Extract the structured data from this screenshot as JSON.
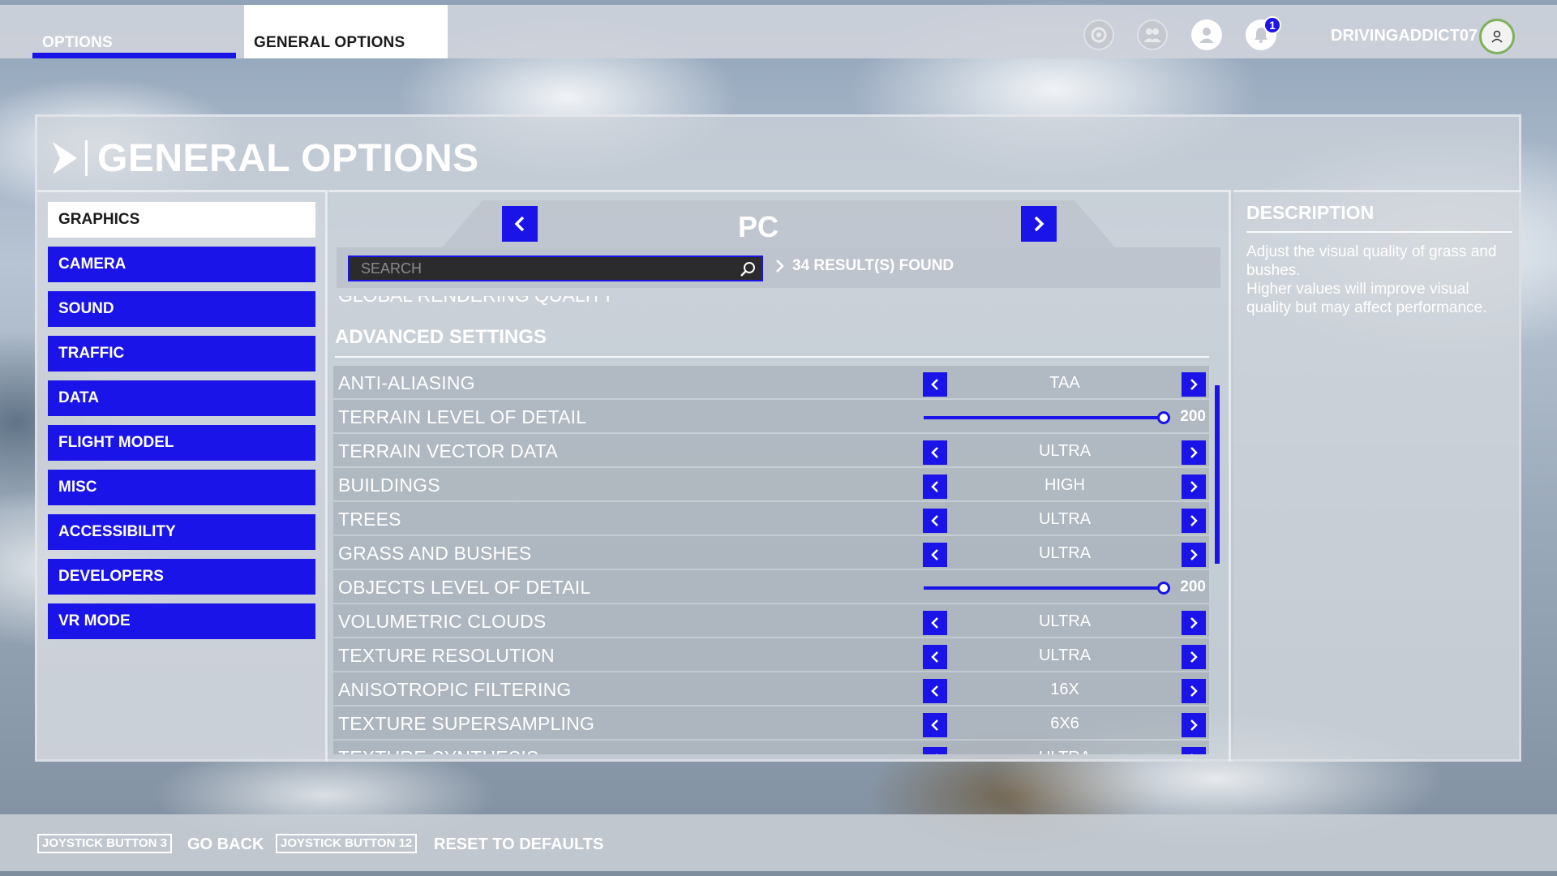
{
  "header": {
    "tabs": [
      {
        "label": "OPTIONS"
      },
      {
        "label": "GENERAL OPTIONS"
      }
    ],
    "notification_count": "1",
    "username": "DRIVINGADDICT07"
  },
  "page_title": "GENERAL OPTIONS",
  "menu": {
    "items": [
      {
        "label": "GRAPHICS",
        "active": true
      },
      {
        "label": "CAMERA"
      },
      {
        "label": "SOUND"
      },
      {
        "label": "TRAFFIC"
      },
      {
        "label": "DATA"
      },
      {
        "label": "FLIGHT MODEL"
      },
      {
        "label": "MISC"
      },
      {
        "label": "ACCESSIBILITY"
      },
      {
        "label": "DEVELOPERS"
      },
      {
        "label": "VR MODE"
      }
    ]
  },
  "preset": {
    "label": "PC"
  },
  "search": {
    "placeholder": "SEARCH",
    "value": ""
  },
  "results_text": "34 RESULT(S) FOUND",
  "cut_row": {
    "label": "GLOBAL RENDERING QUALITY"
  },
  "section_title": "ADVANCED SETTINGS",
  "settings": [
    {
      "label": "ANTI-ALIASING",
      "type": "select",
      "value": "TAA"
    },
    {
      "label": "TERRAIN LEVEL OF DETAIL",
      "type": "slider",
      "value": "200",
      "fraction": 1.0
    },
    {
      "label": "TERRAIN VECTOR DATA",
      "type": "select",
      "value": "ULTRA"
    },
    {
      "label": "BUILDINGS",
      "type": "select",
      "value": "HIGH"
    },
    {
      "label": "TREES",
      "type": "select",
      "value": "ULTRA"
    },
    {
      "label": "GRASS AND BUSHES",
      "type": "select",
      "value": "ULTRA"
    },
    {
      "label": "OBJECTS LEVEL OF DETAIL",
      "type": "slider",
      "value": "200",
      "fraction": 1.0
    },
    {
      "label": "VOLUMETRIC CLOUDS",
      "type": "select",
      "value": "ULTRA"
    },
    {
      "label": "TEXTURE RESOLUTION",
      "type": "select",
      "value": "ULTRA"
    },
    {
      "label": "ANISOTROPIC FILTERING",
      "type": "select",
      "value": "16X"
    },
    {
      "label": "TEXTURE SUPERSAMPLING",
      "type": "select",
      "value": "6X6"
    },
    {
      "label": "TEXTURE SYNTHESIS",
      "type": "select",
      "value": "ULTRA"
    }
  ],
  "description": {
    "title": "DESCRIPTION",
    "line1": "Adjust the visual quality of grass and bushes.",
    "line2": "Higher values will improve visual quality but may affect performance."
  },
  "footer": {
    "back_key": "JOYSTICK BUTTON 3",
    "back_label": "GO BACK",
    "reset_key": "JOYSTICK BUTTON 12",
    "reset_label": "RESET TO DEFAULTS"
  },
  "colors": {
    "accent": "#1a14e8"
  },
  "icons": {
    "top": [
      "achievements-icon",
      "friends-icon",
      "profile-icon",
      "notifications-icon"
    ],
    "nav": [
      "chevron-left-icon",
      "chevron-right-icon"
    ],
    "search": "search-icon"
  }
}
